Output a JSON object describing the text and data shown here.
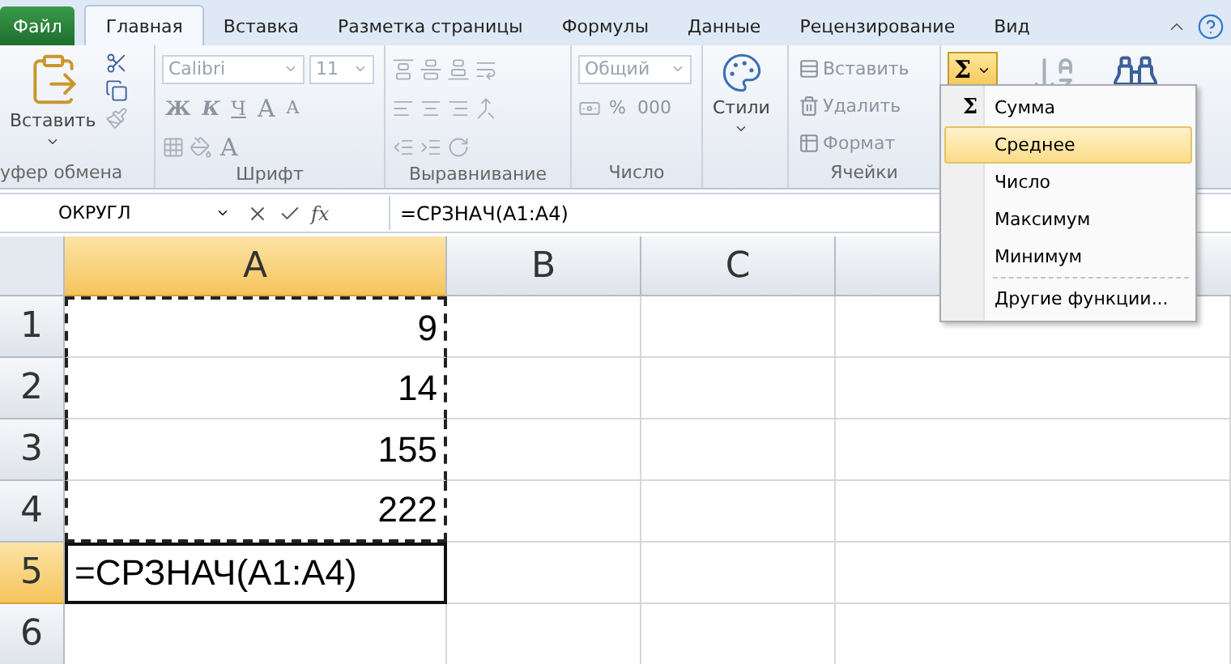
{
  "tabs": [
    {
      "label": "Файл",
      "kind": "file",
      "selected": false
    },
    {
      "label": "Главная",
      "kind": "tab",
      "selected": true
    },
    {
      "label": "Вставка",
      "kind": "tab",
      "selected": false
    },
    {
      "label": "Разметка страницы",
      "kind": "tab",
      "selected": false
    },
    {
      "label": "Формулы",
      "kind": "tab",
      "selected": false
    },
    {
      "label": "Данные",
      "kind": "tab",
      "selected": false
    },
    {
      "label": "Рецензирование",
      "kind": "tab",
      "selected": false
    },
    {
      "label": "Вид",
      "kind": "tab",
      "selected": false
    }
  ],
  "ribbon": {
    "disabled": true,
    "clipboard": {
      "label": "уфер обмена",
      "paste": "Вставить"
    },
    "font": {
      "label": "Шрифт",
      "name": "Calibri",
      "size": "11",
      "bold": "Ж",
      "italic": "К",
      "underline": "Ч",
      "grow": "A",
      "shrink": "A",
      "font_color_button": "A"
    },
    "alignment": {
      "label": "Выравнивание"
    },
    "number": {
      "label": "Число",
      "format": "Общий",
      "percent": "%",
      "thousands": "000"
    },
    "styles": {
      "button": "Стили"
    },
    "cells": {
      "label": "Ячейки",
      "insert": "Вставить",
      "delete": "Удалить",
      "format": "Формат"
    },
    "editing": {
      "autosum": "Σ",
      "open": true
    }
  },
  "formula_bar": {
    "name_box": "ОКРУГЛ",
    "fx": "fx",
    "formula": "=СРЗНАЧ(A1:A4)"
  },
  "columns": [
    {
      "label": "A",
      "selected": true
    },
    {
      "label": "B",
      "selected": false
    },
    {
      "label": "C",
      "selected": false
    }
  ],
  "rows": [
    {
      "label": "1",
      "selected": false,
      "a": "9",
      "in_copy_range": true,
      "active": false,
      "kind": "number"
    },
    {
      "label": "2",
      "selected": false,
      "a": "14",
      "in_copy_range": true,
      "active": false,
      "kind": "number"
    },
    {
      "label": "3",
      "selected": false,
      "a": "155",
      "in_copy_range": true,
      "active": false,
      "kind": "number"
    },
    {
      "label": "4",
      "selected": false,
      "a": "222",
      "in_copy_range": true,
      "active": false,
      "kind": "number"
    },
    {
      "label": "5",
      "selected": true,
      "a": "=СРЗНАЧ(A1:A4)",
      "in_copy_range": false,
      "active": true,
      "kind": "formula"
    },
    {
      "label": "6",
      "selected": false
    }
  ],
  "autosum_menu": [
    {
      "kind": "item",
      "label": "Сумма",
      "icon": "Σ",
      "selected": false
    },
    {
      "kind": "item",
      "label": "Среднее",
      "selected": true
    },
    {
      "kind": "item",
      "label": "Число",
      "selected": false
    },
    {
      "kind": "item",
      "label": "Максимум",
      "selected": false
    },
    {
      "kind": "item",
      "label": "Минимум",
      "selected": false
    },
    {
      "kind": "separator"
    },
    {
      "kind": "item",
      "label": "Другие функции...",
      "selected": false
    }
  ]
}
